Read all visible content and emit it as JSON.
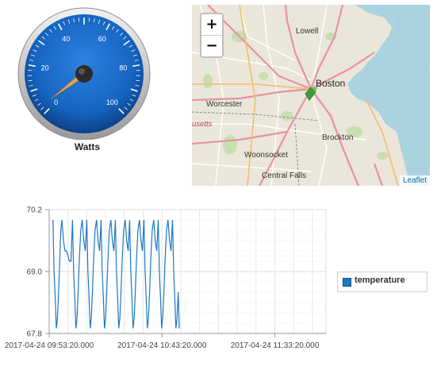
{
  "gauge": {
    "label": "Watts",
    "min": 0,
    "max": 100,
    "value": 3,
    "tick_labels": [
      "0",
      "20",
      "40",
      "60",
      "80",
      "100"
    ],
    "colors": {
      "face": "#1565c0",
      "needle": "#f0a54a",
      "bezel": "#c9c9c9"
    }
  },
  "map": {
    "zoom_in": "+",
    "zoom_out": "−",
    "attribution": "Leaflet",
    "places": [
      {
        "key": "lowell",
        "name": "Lowell"
      },
      {
        "key": "boston",
        "name": "Boston"
      },
      {
        "key": "worcester",
        "name": "Worcester"
      },
      {
        "key": "usetts",
        "name": "usetts"
      },
      {
        "key": "brockton",
        "name": "Brockton"
      },
      {
        "key": "woonsocket",
        "name": "Woonsocket"
      },
      {
        "key": "central_falls",
        "name": "Central Falls"
      }
    ],
    "marker_icon": "map-marker-icon",
    "colors": {
      "land": "#eae6da",
      "water": "#aad3df",
      "major_road": "#e892a2",
      "minor_road": "#ffffff",
      "park": "#c8deb0"
    }
  },
  "chart_data": {
    "type": "line",
    "x_ticks": [
      "2017-04-24 09:53:20.000",
      "2017-04-24 10:43:20.000",
      "2017-04-24 11:33:20.000"
    ],
    "y_ticks": [
      "70.2",
      "69.0",
      "67.8"
    ],
    "ylim": [
      67.8,
      70.2
    ],
    "xlim": [
      "2017-04-24 09:53:20",
      "2017-04-24 11:56:00"
    ],
    "grid": true,
    "legend_position": "right",
    "series": [
      {
        "name": "temperature",
        "color": "#1f77c4",
        "x": [
          "09:55:00",
          "09:55:30",
          "09:56:00",
          "09:56:30",
          "09:57:00",
          "09:57:30",
          "09:58:00",
          "09:58:30",
          "09:59:00",
          "09:59:40",
          "10:00:20",
          "10:01:00",
          "10:01:40",
          "10:02:20",
          "10:03:00",
          "10:03:40",
          "10:04:10",
          "10:04:40",
          "10:05:10",
          "10:05:40",
          "10:06:10",
          "10:06:40",
          "10:07:20",
          "10:08:00",
          "10:08:40",
          "10:09:20",
          "10:10:00",
          "10:10:30",
          "10:11:00",
          "10:11:30",
          "10:12:00",
          "10:12:30",
          "10:13:00",
          "10:13:40",
          "10:14:20",
          "10:15:00",
          "10:15:40",
          "10:16:20",
          "10:16:50",
          "10:17:20",
          "10:17:50",
          "10:18:20",
          "10:18:50",
          "10:19:20",
          "10:20:00",
          "10:20:40",
          "10:21:20",
          "10:22:00",
          "10:22:40",
          "10:23:10",
          "10:23:40",
          "10:24:10",
          "10:24:40",
          "10:25:10",
          "10:25:40",
          "10:26:20",
          "10:27:00",
          "10:27:40",
          "10:28:20",
          "10:29:00",
          "10:29:30",
          "10:30:00",
          "10:30:30",
          "10:31:00",
          "10:31:30",
          "10:32:00",
          "10:32:40",
          "10:33:20",
          "10:34:00",
          "10:34:40",
          "10:35:20",
          "10:35:50",
          "10:36:20",
          "10:36:50",
          "10:37:20",
          "10:37:50",
          "10:38:20",
          "10:39:00",
          "10:39:40",
          "10:40:20",
          "10:41:00",
          "10:41:40",
          "10:42:10",
          "10:42:40",
          "10:43:10",
          "10:43:40",
          "10:44:10",
          "10:44:40",
          "10:45:20",
          "10:46:00",
          "10:46:40",
          "10:47:20",
          "10:48:00",
          "10:48:30",
          "10:49:00",
          "10:49:30",
          "10:50:00",
          "10:50:30",
          "10:51:00"
        ],
        "values": [
          70.0,
          69.0,
          68.5,
          67.9,
          68.1,
          68.6,
          69.2,
          69.8,
          70.0,
          69.6,
          69.4,
          69.4,
          69.3,
          69.2,
          69.2,
          70.0,
          69.0,
          68.5,
          67.9,
          68.1,
          68.6,
          69.2,
          69.8,
          70.0,
          69.6,
          69.4,
          70.0,
          69.0,
          68.5,
          67.9,
          68.1,
          68.6,
          69.2,
          69.8,
          70.0,
          69.6,
          69.4,
          70.0,
          69.0,
          68.5,
          67.9,
          68.1,
          68.6,
          69.2,
          69.8,
          70.0,
          69.6,
          69.4,
          70.0,
          69.0,
          68.5,
          67.9,
          68.1,
          68.6,
          69.2,
          69.8,
          70.0,
          69.6,
          69.4,
          70.0,
          69.0,
          68.5,
          67.9,
          68.1,
          68.6,
          69.2,
          69.8,
          70.0,
          69.6,
          69.4,
          70.0,
          69.0,
          68.5,
          67.9,
          68.1,
          68.6,
          69.2,
          69.8,
          70.0,
          69.6,
          69.4,
          70.0,
          69.0,
          68.5,
          67.9,
          68.1,
          68.6,
          69.2,
          69.8,
          70.0,
          69.6,
          69.4,
          70.0,
          69.0,
          68.5,
          67.9,
          68.1,
          68.6,
          67.9
        ]
      }
    ]
  }
}
